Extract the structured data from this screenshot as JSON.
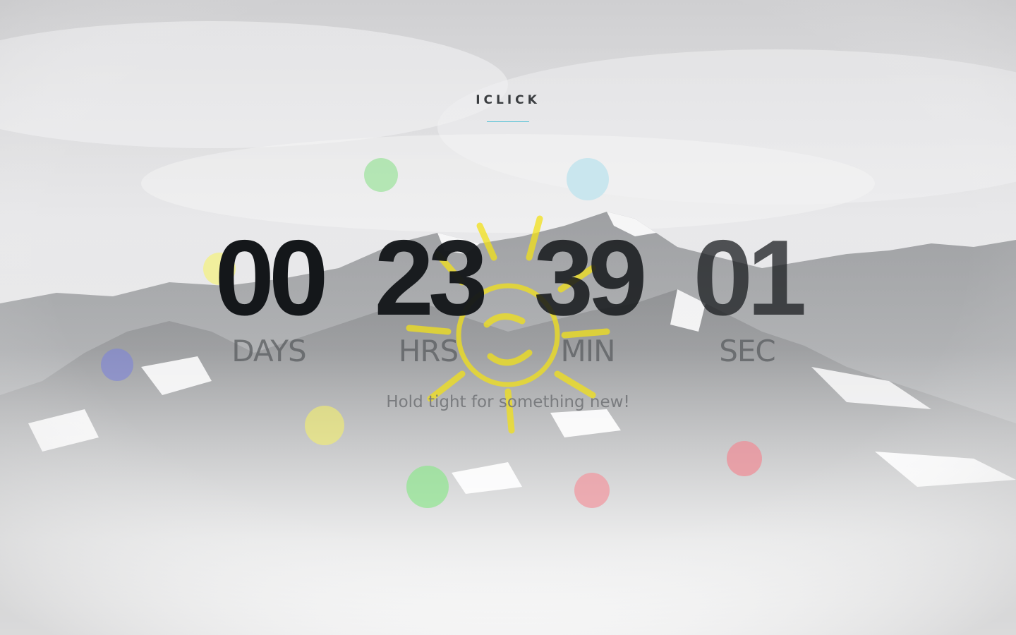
{
  "brand": {
    "name": "ICLICK",
    "accent_color": "#5cc3d6"
  },
  "countdown": {
    "days": {
      "value": "00",
      "label": "DAYS"
    },
    "hours": {
      "value": "23",
      "label": "HRS"
    },
    "minutes": {
      "value": "39",
      "label": "MIN"
    },
    "seconds": {
      "value": "01",
      "label": "SEC"
    }
  },
  "tagline": "Hold tight for something new!",
  "background": {
    "scene": "snowy-mountain-range",
    "overlay": "white-fade"
  },
  "decor": {
    "sun_icon": "sun-doodle-icon",
    "sun_color": "#f2e11a",
    "dot_colors": [
      "#9be39b",
      "#bfe3ee",
      "#f2f08a",
      "#7f86d6",
      "#f5f06a",
      "#8ee68e",
      "#f09aa2",
      "#ee8f98"
    ]
  }
}
